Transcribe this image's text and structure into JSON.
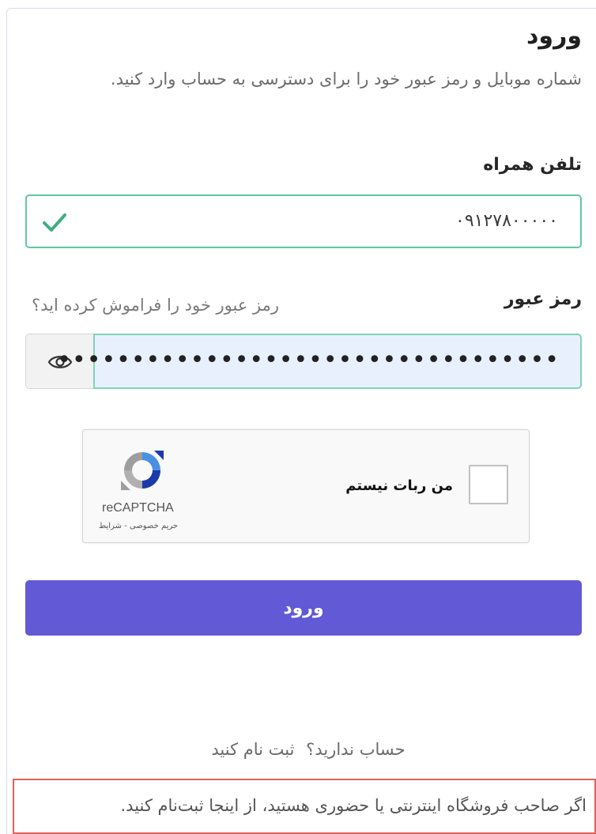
{
  "header": {
    "title": "ورود",
    "subtitle": "شماره موبایل و رمز عبور خود را برای دسترسی به حساب وارد کنید."
  },
  "phone": {
    "label": "تلفن همراه",
    "value": "۰۹۱۲۷۸۰۰۰۰۰",
    "status": "valid",
    "icon": "check-icon"
  },
  "password": {
    "label": "رمز عبور",
    "forgot_link": "رمز عبور خود را فراموش کرده اید؟",
    "masked_value": "••••••••••••••••••••••••••••••••••",
    "toggle_icon": "eye-icon"
  },
  "recaptcha": {
    "checkbox_label": "من ربات نیستم",
    "brand": "reCAPTCHA",
    "links": "حریم خصوصی - شرایط"
  },
  "actions": {
    "submit_label": "ورود"
  },
  "footer": {
    "no_account": "حساب ندارید؟",
    "signup_link": "ثبت نام کنید",
    "store_owner_text": "اگر صاحب فروشگاه اینترنتی یا حضوری هستید، از اینجا ثبت‌نام کنید."
  },
  "colors": {
    "accent": "#6259d7",
    "valid_border": "#5fc9a0",
    "banner_border": "#e0605c"
  }
}
